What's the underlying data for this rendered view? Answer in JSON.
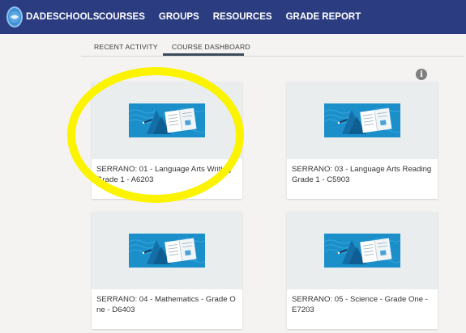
{
  "header": {
    "logo_text": "DADESCHOOLS",
    "nav": [
      "COURSES",
      "GROUPS",
      "RESOURCES",
      "GRADE REPORT"
    ]
  },
  "tabs": {
    "recent_activity": "RECENT ACTIVITY",
    "course_dashboard": "COURSE DASHBOARD"
  },
  "info_icon": "i",
  "courses": [
    {
      "title": "SERRANO: 01 - Language Arts Writing Grade 1 - A6203"
    },
    {
      "title": "SERRANO: 03 - Language Arts Reading Grade 1 - C5903"
    },
    {
      "title": "SERRANO: 04 - Mathematics - Grade O ne - D6403"
    },
    {
      "title": "SERRANO: 05 - Science - Grade One - E7203"
    }
  ],
  "colors": {
    "header_bg": "#2b3c80",
    "banner_bg": "#1b8fc9",
    "highlight": "#fbf300"
  }
}
